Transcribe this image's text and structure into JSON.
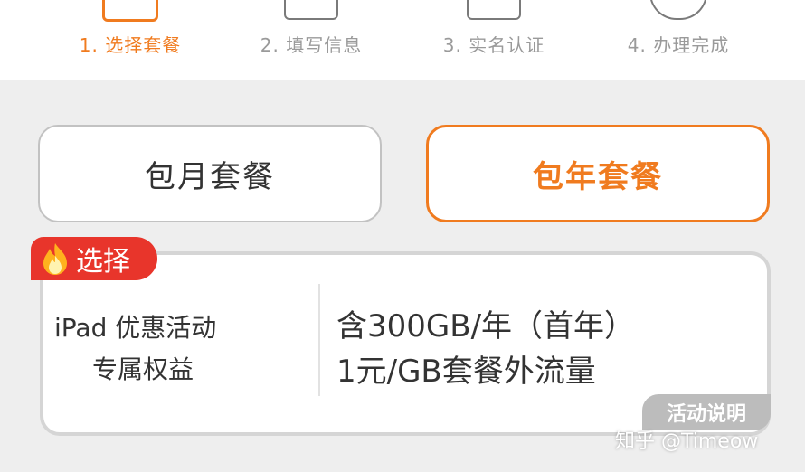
{
  "steps": [
    {
      "label": "1. 选择套餐",
      "active": true
    },
    {
      "label": "2. 填写信息",
      "active": false
    },
    {
      "label": "3. 实名认证",
      "active": false
    },
    {
      "label": "4. 办理完成",
      "active": false
    }
  ],
  "plans": {
    "monthly": "包月套餐",
    "yearly": "包年套餐",
    "selected": "yearly"
  },
  "badge": {
    "label": "选择",
    "icon": "flame-icon"
  },
  "card": {
    "title_line1": "iPad 优惠活动",
    "title_line2": "专属权益",
    "benefit1": "含300GB/年（首年）",
    "benefit2": "1元/GB套餐外流量",
    "help_button": "活动说明"
  },
  "watermark": "知乎 @Timeow",
  "colors": {
    "accent": "#f07b1f",
    "badge": "#e8352b"
  }
}
